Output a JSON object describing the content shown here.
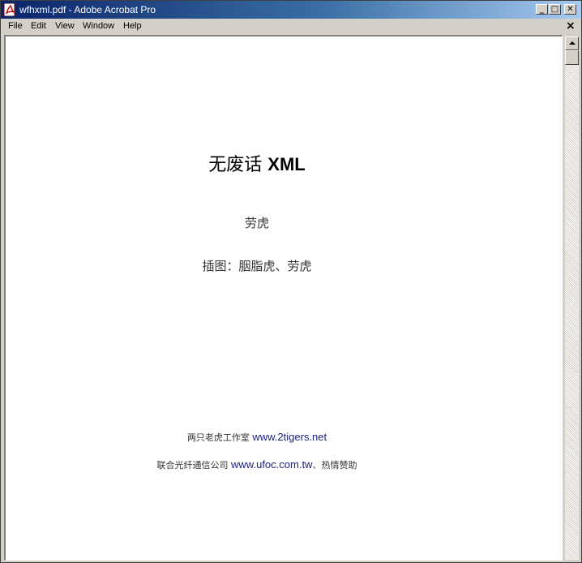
{
  "window": {
    "title": "wfhxml.pdf - Adobe Acrobat Pro",
    "app_icon": "pdf-document-icon",
    "minimize_glyph": "_",
    "maximize_glyph": "□",
    "close_glyph": "✕"
  },
  "menubar": {
    "items": [
      {
        "label": "File"
      },
      {
        "label": "Edit"
      },
      {
        "label": "View"
      },
      {
        "label": "Window"
      },
      {
        "label": "Help"
      }
    ],
    "close_glyph": "×"
  },
  "document": {
    "title_cn": "无废话",
    "title_xml": "XML",
    "author": "劳虎",
    "illustration": "插图：胭脂虎、劳虎",
    "credit_line1_prefix": "两只老虎工作室",
    "credit_line1_url": "www.2tigers.net",
    "credit_line2_prefix": "联合光纤通信公司",
    "credit_line2_url": "www.ufoc.com.tw",
    "credit_line2_suffix": "、热情赞助"
  },
  "colors": {
    "titlebar_start": "#0a246a",
    "titlebar_end": "#a6caf0",
    "chrome": "#d4d0c8",
    "link": "#1a237e"
  }
}
